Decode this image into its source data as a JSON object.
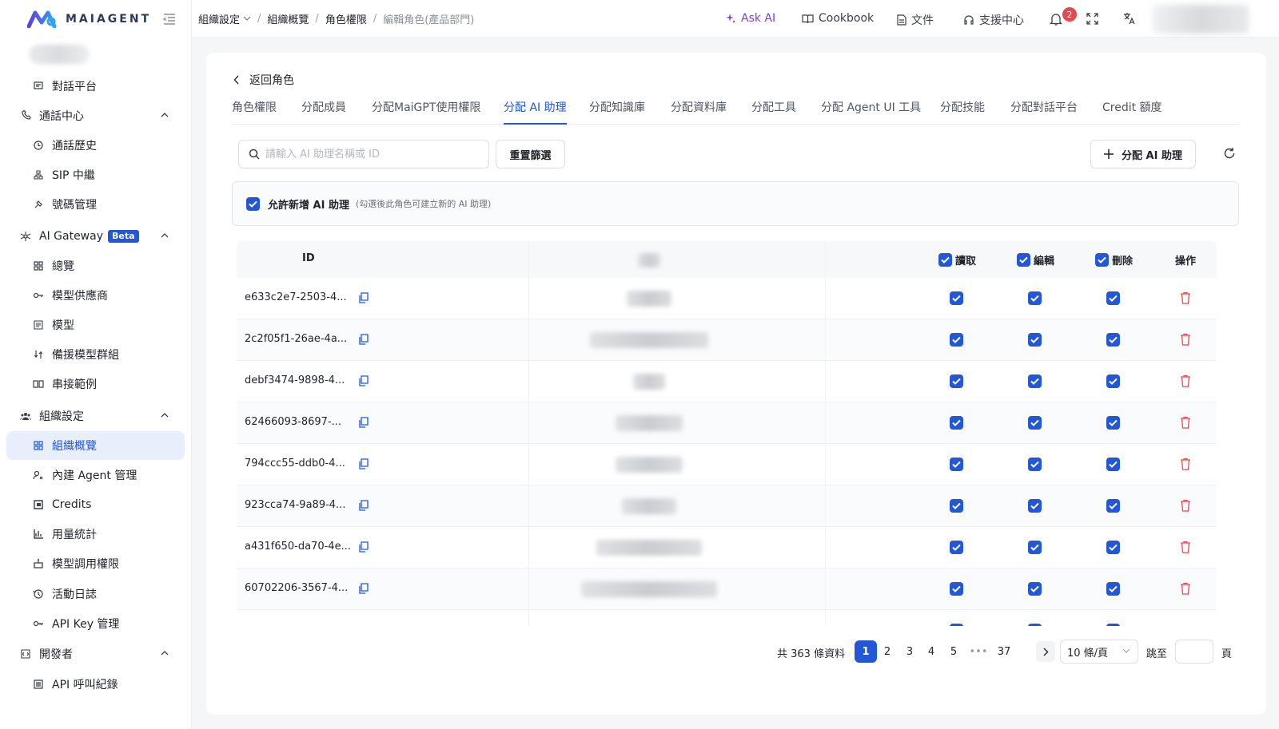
{
  "app": {
    "logo_text": "MAIAGENT"
  },
  "sidebar": {
    "items": [
      {
        "label": "對話平台",
        "icon": "chat-platform-icon",
        "type": "sub"
      },
      {
        "label": "通話中心",
        "icon": "phone-icon",
        "type": "group"
      },
      {
        "label": "通話歷史",
        "icon": "history-icon",
        "type": "sub"
      },
      {
        "label": "SIP 中繼",
        "icon": "sip-icon",
        "type": "sub"
      },
      {
        "label": "號碼管理",
        "icon": "number-icon",
        "type": "sub"
      },
      {
        "label": "AI Gateway",
        "icon": "gateway-icon",
        "type": "group",
        "badge": "Beta"
      },
      {
        "label": "總覽",
        "icon": "dashboard-icon",
        "type": "sub"
      },
      {
        "label": "模型供應商",
        "icon": "key-link-icon",
        "type": "sub"
      },
      {
        "label": "模型",
        "icon": "model-icon",
        "type": "sub"
      },
      {
        "label": "備援模型群組",
        "icon": "fallback-icon",
        "type": "sub"
      },
      {
        "label": "串接範例",
        "icon": "book-icon",
        "type": "sub"
      },
      {
        "label": "組織設定",
        "icon": "team-icon",
        "type": "group"
      },
      {
        "label": "組織概覽",
        "icon": "dashboard-icon",
        "type": "sub",
        "active": true
      },
      {
        "label": "內建 Agent 管理",
        "icon": "agent-icon",
        "type": "sub"
      },
      {
        "label": "Credits",
        "icon": "credits-icon",
        "type": "sub"
      },
      {
        "label": "用量統計",
        "icon": "bar-chart-icon",
        "type": "sub"
      },
      {
        "label": "模型調用權限",
        "icon": "robot-icon",
        "type": "sub"
      },
      {
        "label": "活動日誌",
        "icon": "activity-icon",
        "type": "sub"
      },
      {
        "label": "API Key 管理",
        "icon": "key-icon",
        "type": "sub"
      },
      {
        "label": "開發者",
        "icon": "developer-icon",
        "type": "group"
      },
      {
        "label": "API 呼叫紀錄",
        "icon": "log-icon",
        "type": "sub"
      }
    ]
  },
  "topbar": {
    "breadcrumb": [
      "組織設定",
      "組織概覽",
      "角色權限",
      "編輯角色(產品部門)"
    ],
    "ask_ai": "Ask AI",
    "cookbook": "Cookbook",
    "docs": "文件",
    "support": "支援中心",
    "notification_count": "2"
  },
  "page": {
    "back_label": "返回角色",
    "tabs": [
      "角色權限",
      "分配成員",
      "分配MaiGPT使用權限",
      "分配 AI 助理",
      "分配知識庫",
      "分配資料庫",
      "分配工具",
      "分配 Agent UI 工具",
      "分配技能",
      "分配對話平台",
      "Credit 額度"
    ],
    "active_tab": 3,
    "search_placeholder": "請輸入 AI 助理名稱或 ID",
    "reset_label": "重置篩選",
    "assign_label": "分配 AI 助理",
    "allow_label": "允許新增 AI 助理",
    "allow_hint": "(勾選後此角色可建立新的 AI 助理)",
    "allow_checked": true
  },
  "table": {
    "headers": {
      "id": "ID",
      "read": "讀取",
      "edit": "編輯",
      "delete": "刪除",
      "actions": "操作"
    },
    "rows": [
      {
        "id": "e633c2e7-2503-4...",
        "read": true,
        "edit": true,
        "delete": true
      },
      {
        "id": "2c2f05f1-26ae-4a...",
        "read": true,
        "edit": true,
        "delete": true
      },
      {
        "id": "debf3474-9898-4...",
        "read": true,
        "edit": true,
        "delete": true
      },
      {
        "id": "62466093-8697-...",
        "read": true,
        "edit": true,
        "delete": true
      },
      {
        "id": "794ccc55-ddb0-4...",
        "read": true,
        "edit": true,
        "delete": true
      },
      {
        "id": "923cca74-9a89-4...",
        "read": true,
        "edit": true,
        "delete": true
      },
      {
        "id": "a431f650-da70-4e...",
        "read": true,
        "edit": true,
        "delete": true
      },
      {
        "id": "60702206-3567-4...",
        "read": true,
        "edit": true,
        "delete": true
      }
    ]
  },
  "pagination": {
    "total_text": "共 363 條資料",
    "pages": [
      "1",
      "2",
      "3",
      "4",
      "5",
      "•••",
      "37"
    ],
    "current": "1",
    "page_size": "10 條/頁",
    "jump_label": "跳至",
    "jump_unit": "頁"
  },
  "colors": {
    "primary": "#2157d8",
    "danger": "#e5484d",
    "ask_ai": "#7b3fe4"
  }
}
